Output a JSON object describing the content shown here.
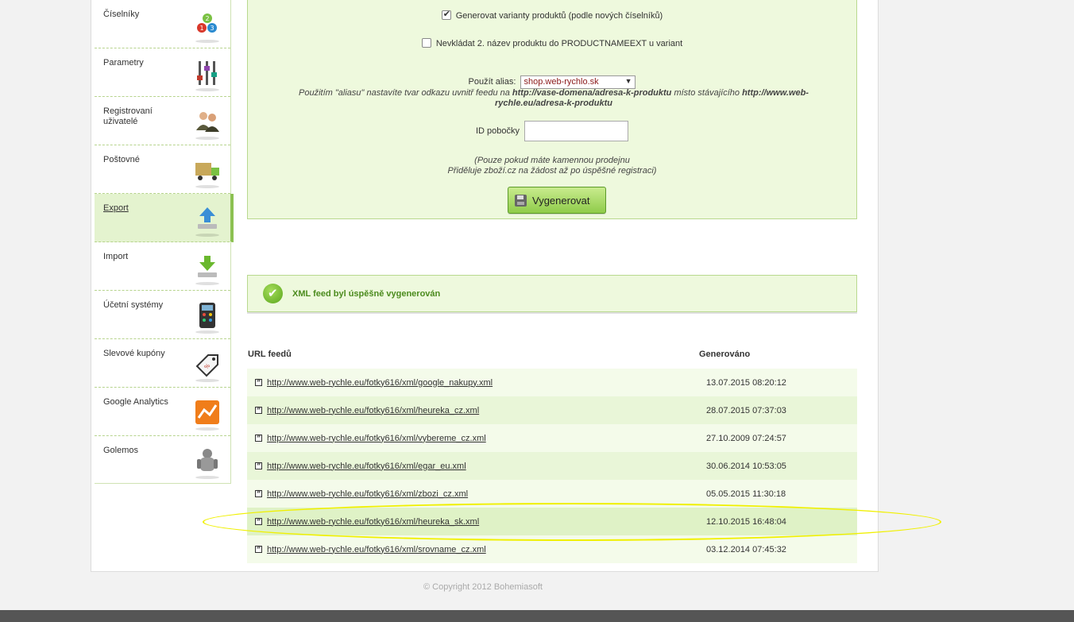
{
  "sidebar": {
    "items": [
      {
        "label": "Číselníky",
        "icon": "numbers-icon"
      },
      {
        "label": "Parametry",
        "icon": "sliders-icon"
      },
      {
        "label": "Registrovaní uživatelé",
        "icon": "users-icon"
      },
      {
        "label": "Poštovné",
        "icon": "delivery-truck-icon"
      },
      {
        "label": "Export",
        "icon": "upload-icon"
      },
      {
        "label": "Import",
        "icon": "download-icon"
      },
      {
        "label": "Účetní systémy",
        "icon": "calculator-icon"
      },
      {
        "label": "Slevové kupóny",
        "icon": "coupon-tag-icon"
      },
      {
        "label": "Google Analytics",
        "icon": "analytics-icon"
      },
      {
        "label": "Golemos",
        "icon": "golem-icon"
      }
    ],
    "active_index": 4
  },
  "form": {
    "generate_variants_label": "Generovat varianty produktů (podle nových číselníků)",
    "generate_variants_checked": true,
    "no_second_name_label": "Nevkládat 2. název produktu do PRODUCTNAMEEXT u variant",
    "no_second_name_checked": false,
    "alias_label": "Použít alias:",
    "alias_value": "shop.web-rychlo.sk",
    "alias_note_1": "Použitím \"aliasu\" nastavíte tvar odkazu uvnitř feedu na ",
    "alias_note_url1": "http://vase-domena/adresa-k-produktu",
    "alias_note_2": " místo stávajícího ",
    "alias_note_url2": "http://www.web-rychle.eu/adresa-k-produktu",
    "branch_label": "ID pobočky",
    "branch_value": "",
    "branch_note_1": "(Pouze pokud máte kamennou prodejnu",
    "branch_note_2": "Přiděluje zboží.cz na žádost až po úspěšné registraci)",
    "generate_button": "Vygenerovat"
  },
  "success_message": "XML feed byl úspěšně vygenerován",
  "feeds": {
    "col_url": "URL feedů",
    "col_generated": "Generováno",
    "rows": [
      {
        "url": "http://www.web-rychle.eu/fotky616/xml/google_nakupy.xml",
        "generated": "13.07.2015 08:20:12"
      },
      {
        "url": "http://www.web-rychle.eu/fotky616/xml/heureka_cz.xml",
        "generated": "28.07.2015 07:37:03"
      },
      {
        "url": "http://www.web-rychle.eu/fotky616/xml/vybereme_cz.xml",
        "generated": "27.10.2009 07:24:57"
      },
      {
        "url": "http://www.web-rychle.eu/fotky616/xml/egar_eu.xml",
        "generated": "30.06.2014 10:53:05"
      },
      {
        "url": "http://www.web-rychle.eu/fotky616/xml/zbozi_cz.xml",
        "generated": "05.05.2015 11:30:18"
      },
      {
        "url": "http://www.web-rychle.eu/fotky616/xml/heureka_sk.xml",
        "generated": "12.10.2015 16:48:04"
      },
      {
        "url": "http://www.web-rychle.eu/fotky616/xml/srovname_cz.xml",
        "generated": "03.12.2014 07:45:32"
      }
    ],
    "highlighted_index": 5
  },
  "footer": {
    "copyright": "© Copyright 2012 Bohemiasoft"
  },
  "colors": {
    "accent_green": "#8cc152",
    "panel_bg": "#eef9dd",
    "highlight_ellipse": "#f0f000"
  }
}
